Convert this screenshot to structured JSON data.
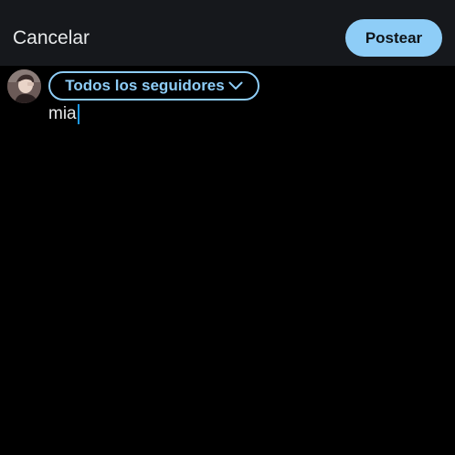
{
  "header": {
    "cancel_label": "Cancelar",
    "post_label": "Postear"
  },
  "composer": {
    "audience_label": "Todos los seguidores",
    "text": "mia"
  },
  "icons": {
    "avatar": "user-avatar",
    "audience_chevron": "chevron-down-icon"
  },
  "colors": {
    "background": "#000000",
    "topbar": "#16181c",
    "accent": "#8ecdf7",
    "caret": "#1d9bf0",
    "text": "#e7e9ea"
  }
}
